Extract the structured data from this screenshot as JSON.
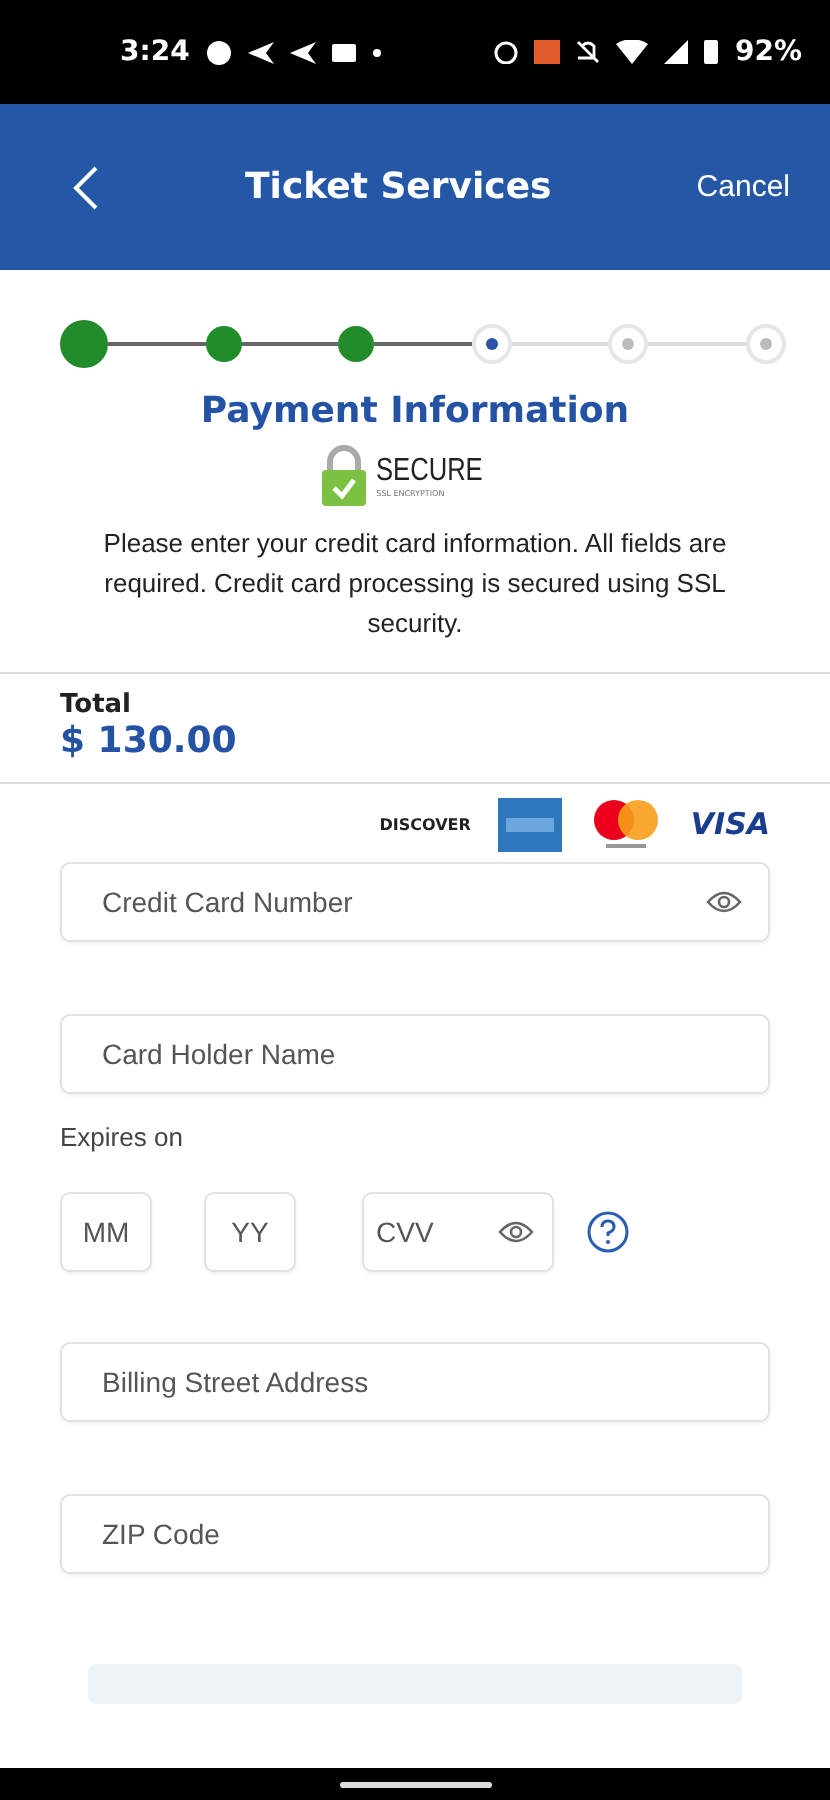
{
  "status_bar": {
    "time": "3:24",
    "battery": "92%"
  },
  "header": {
    "title": "Ticket Services",
    "cancel": "Cancel"
  },
  "steps": [
    {
      "completed": true,
      "current": false
    },
    {
      "completed": true,
      "current": false
    },
    {
      "completed": true,
      "current": false
    },
    {
      "completed": false,
      "current": true
    },
    {
      "completed": false,
      "current": false
    },
    {
      "completed": false,
      "current": false
    }
  ],
  "heading": "Payment Information",
  "secure_badge": {
    "title": "SECURE",
    "subtitle": "SSL ENCRYPTION"
  },
  "intro": "Please enter your credit card information.  All fields are required. Credit card processing is secured using SSL security.",
  "total": {
    "label": "Total",
    "amount": "$ 130.00"
  },
  "card_brands": [
    {
      "kind": "discover",
      "label": "DISCOVER"
    },
    {
      "kind": "amex"
    },
    {
      "kind": "mastercard"
    },
    {
      "kind": "visa",
      "label": "VISA"
    }
  ],
  "fields": [
    {
      "placeholder": "Credit Card Number",
      "kind": "secret"
    },
    {
      "placeholder": "Card Holder Name",
      "kind": "text"
    }
  ],
  "expiry": {
    "label": "Expires on",
    "month": {
      "placeholder": "MM"
    },
    "year": {
      "placeholder": "YY"
    },
    "cvv": {
      "placeholder": "CVV"
    }
  },
  "address_fields": [
    {
      "placeholder": "Billing Street Address"
    },
    {
      "placeholder": "ZIP Code"
    }
  ]
}
